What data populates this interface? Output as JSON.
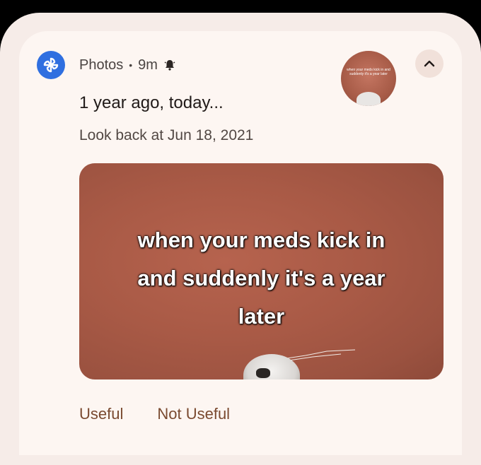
{
  "notification": {
    "app_name": "Photos",
    "separator": "•",
    "time": "9m",
    "title": "1 year ago, today...",
    "subtitle": "Look back at Jun 18, 2021",
    "image_caption_lines": [
      "when your meds kick in",
      "and suddenly it's a year",
      "later"
    ],
    "thumbnail_caption": "when your meds kick in and suddenly it's a year later",
    "actions": {
      "useful": "Useful",
      "not_useful": "Not Useful"
    },
    "icons": {
      "app": "photos-pinwheel-icon",
      "alert": "bell-icon",
      "expand": "chevron-up-icon"
    },
    "colors": {
      "app_icon_bg": "#2f6fe0",
      "action_text": "#7a4a30",
      "card_bg": "#fdf6f2"
    }
  }
}
